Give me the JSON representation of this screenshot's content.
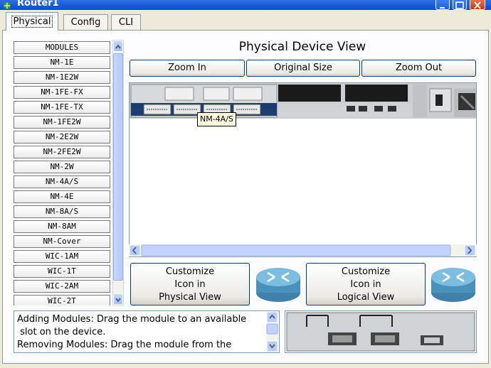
{
  "window": {
    "title": "Router1",
    "controls": [
      "minimize-icon",
      "maximize-icon",
      "close-icon"
    ]
  },
  "tabs": [
    {
      "label": "Physical",
      "active": true
    },
    {
      "label": "Config",
      "active": false
    },
    {
      "label": "CLI",
      "active": false
    }
  ],
  "modules": {
    "header": "MODULES",
    "items": [
      "NM-1E",
      "NM-1E2W",
      "NM-1FE-FX",
      "NM-1FE-TX",
      "NM-1FE2W",
      "NM-2E2W",
      "NM-2FE2W",
      "NM-2W",
      "NM-4A/S",
      "NM-4E",
      "NM-8A/S",
      "NM-8AM",
      "NM-Cover",
      "WIC-1AM",
      "WIC-1T",
      "WIC-2AM",
      "WIC-2T"
    ]
  },
  "device_view": {
    "title": "Physical Device View",
    "zoom_in": "Zoom In",
    "original_size": "Original Size",
    "zoom_out": "Zoom Out",
    "tooltip": "NM-4A/S"
  },
  "customize": {
    "physical": [
      "Customize",
      "Icon in",
      "Physical View"
    ],
    "logical": [
      "Customize",
      "Icon in",
      "Logical View"
    ]
  },
  "info": {
    "lines": [
      "Adding Modules: Drag the module to an available",
      " slot on the device.",
      "Removing Modules: Drag the module from the"
    ]
  },
  "colors": {
    "titlebar": "#0a4ad0",
    "face_plate": "#cfd3d6",
    "dark_panel": "#1a1a1a",
    "router_icon": "#5aa0c8"
  }
}
